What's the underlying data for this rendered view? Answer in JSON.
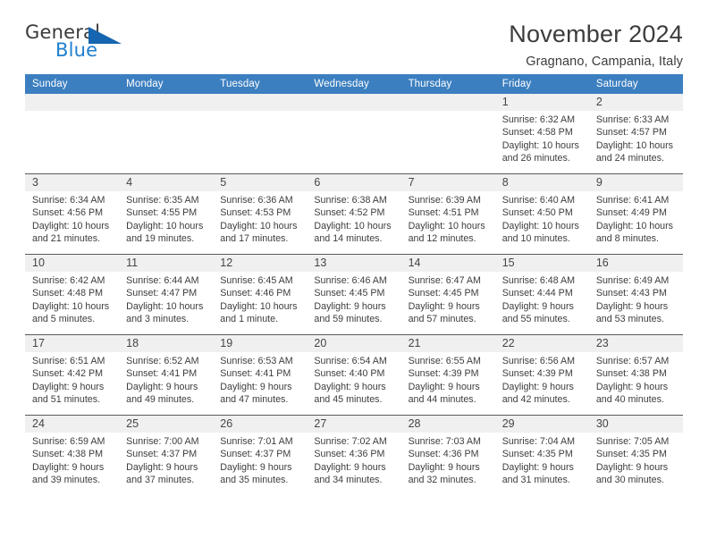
{
  "brand": {
    "name_part1": "General",
    "name_part2": "Blue",
    "color_dark": "#3a3a3a",
    "color_blue": "#1f7fd0",
    "triangle_color": "#1565b0"
  },
  "header": {
    "title": "November 2024",
    "subtitle": "Gragnano, Campania, Italy",
    "header_bar_color": "#3c7fc0"
  },
  "weekdays": [
    "Sunday",
    "Monday",
    "Tuesday",
    "Wednesday",
    "Thursday",
    "Friday",
    "Saturday"
  ],
  "weeks": [
    [
      {
        "day": "",
        "sunrise": "",
        "sunset": "",
        "daylight": "",
        "empty": true
      },
      {
        "day": "",
        "sunrise": "",
        "sunset": "",
        "daylight": "",
        "empty": true
      },
      {
        "day": "",
        "sunrise": "",
        "sunset": "",
        "daylight": "",
        "empty": true
      },
      {
        "day": "",
        "sunrise": "",
        "sunset": "",
        "daylight": "",
        "empty": true
      },
      {
        "day": "",
        "sunrise": "",
        "sunset": "",
        "daylight": "",
        "empty": true
      },
      {
        "day": "1",
        "sunrise": "Sunrise: 6:32 AM",
        "sunset": "Sunset: 4:58 PM",
        "daylight": "Daylight: 10 hours and 26 minutes."
      },
      {
        "day": "2",
        "sunrise": "Sunrise: 6:33 AM",
        "sunset": "Sunset: 4:57 PM",
        "daylight": "Daylight: 10 hours and 24 minutes."
      }
    ],
    [
      {
        "day": "3",
        "sunrise": "Sunrise: 6:34 AM",
        "sunset": "Sunset: 4:56 PM",
        "daylight": "Daylight: 10 hours and 21 minutes."
      },
      {
        "day": "4",
        "sunrise": "Sunrise: 6:35 AM",
        "sunset": "Sunset: 4:55 PM",
        "daylight": "Daylight: 10 hours and 19 minutes."
      },
      {
        "day": "5",
        "sunrise": "Sunrise: 6:36 AM",
        "sunset": "Sunset: 4:53 PM",
        "daylight": "Daylight: 10 hours and 17 minutes."
      },
      {
        "day": "6",
        "sunrise": "Sunrise: 6:38 AM",
        "sunset": "Sunset: 4:52 PM",
        "daylight": "Daylight: 10 hours and 14 minutes."
      },
      {
        "day": "7",
        "sunrise": "Sunrise: 6:39 AM",
        "sunset": "Sunset: 4:51 PM",
        "daylight": "Daylight: 10 hours and 12 minutes."
      },
      {
        "day": "8",
        "sunrise": "Sunrise: 6:40 AM",
        "sunset": "Sunset: 4:50 PM",
        "daylight": "Daylight: 10 hours and 10 minutes."
      },
      {
        "day": "9",
        "sunrise": "Sunrise: 6:41 AM",
        "sunset": "Sunset: 4:49 PM",
        "daylight": "Daylight: 10 hours and 8 minutes."
      }
    ],
    [
      {
        "day": "10",
        "sunrise": "Sunrise: 6:42 AM",
        "sunset": "Sunset: 4:48 PM",
        "daylight": "Daylight: 10 hours and 5 minutes."
      },
      {
        "day": "11",
        "sunrise": "Sunrise: 6:44 AM",
        "sunset": "Sunset: 4:47 PM",
        "daylight": "Daylight: 10 hours and 3 minutes."
      },
      {
        "day": "12",
        "sunrise": "Sunrise: 6:45 AM",
        "sunset": "Sunset: 4:46 PM",
        "daylight": "Daylight: 10 hours and 1 minute."
      },
      {
        "day": "13",
        "sunrise": "Sunrise: 6:46 AM",
        "sunset": "Sunset: 4:45 PM",
        "daylight": "Daylight: 9 hours and 59 minutes."
      },
      {
        "day": "14",
        "sunrise": "Sunrise: 6:47 AM",
        "sunset": "Sunset: 4:45 PM",
        "daylight": "Daylight: 9 hours and 57 minutes."
      },
      {
        "day": "15",
        "sunrise": "Sunrise: 6:48 AM",
        "sunset": "Sunset: 4:44 PM",
        "daylight": "Daylight: 9 hours and 55 minutes."
      },
      {
        "day": "16",
        "sunrise": "Sunrise: 6:49 AM",
        "sunset": "Sunset: 4:43 PM",
        "daylight": "Daylight: 9 hours and 53 minutes."
      }
    ],
    [
      {
        "day": "17",
        "sunrise": "Sunrise: 6:51 AM",
        "sunset": "Sunset: 4:42 PM",
        "daylight": "Daylight: 9 hours and 51 minutes."
      },
      {
        "day": "18",
        "sunrise": "Sunrise: 6:52 AM",
        "sunset": "Sunset: 4:41 PM",
        "daylight": "Daylight: 9 hours and 49 minutes."
      },
      {
        "day": "19",
        "sunrise": "Sunrise: 6:53 AM",
        "sunset": "Sunset: 4:41 PM",
        "daylight": "Daylight: 9 hours and 47 minutes."
      },
      {
        "day": "20",
        "sunrise": "Sunrise: 6:54 AM",
        "sunset": "Sunset: 4:40 PM",
        "daylight": "Daylight: 9 hours and 45 minutes."
      },
      {
        "day": "21",
        "sunrise": "Sunrise: 6:55 AM",
        "sunset": "Sunset: 4:39 PM",
        "daylight": "Daylight: 9 hours and 44 minutes."
      },
      {
        "day": "22",
        "sunrise": "Sunrise: 6:56 AM",
        "sunset": "Sunset: 4:39 PM",
        "daylight": "Daylight: 9 hours and 42 minutes."
      },
      {
        "day": "23",
        "sunrise": "Sunrise: 6:57 AM",
        "sunset": "Sunset: 4:38 PM",
        "daylight": "Daylight: 9 hours and 40 minutes."
      }
    ],
    [
      {
        "day": "24",
        "sunrise": "Sunrise: 6:59 AM",
        "sunset": "Sunset: 4:38 PM",
        "daylight": "Daylight: 9 hours and 39 minutes."
      },
      {
        "day": "25",
        "sunrise": "Sunrise: 7:00 AM",
        "sunset": "Sunset: 4:37 PM",
        "daylight": "Daylight: 9 hours and 37 minutes."
      },
      {
        "day": "26",
        "sunrise": "Sunrise: 7:01 AM",
        "sunset": "Sunset: 4:37 PM",
        "daylight": "Daylight: 9 hours and 35 minutes."
      },
      {
        "day": "27",
        "sunrise": "Sunrise: 7:02 AM",
        "sunset": "Sunset: 4:36 PM",
        "daylight": "Daylight: 9 hours and 34 minutes."
      },
      {
        "day": "28",
        "sunrise": "Sunrise: 7:03 AM",
        "sunset": "Sunset: 4:36 PM",
        "daylight": "Daylight: 9 hours and 32 minutes."
      },
      {
        "day": "29",
        "sunrise": "Sunrise: 7:04 AM",
        "sunset": "Sunset: 4:35 PM",
        "daylight": "Daylight: 9 hours and 31 minutes."
      },
      {
        "day": "30",
        "sunrise": "Sunrise: 7:05 AM",
        "sunset": "Sunset: 4:35 PM",
        "daylight": "Daylight: 9 hours and 30 minutes."
      }
    ]
  ]
}
